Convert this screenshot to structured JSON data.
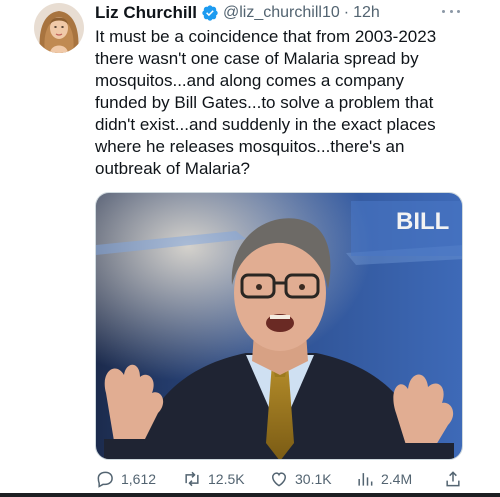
{
  "tweet": {
    "author_name": "Liz Churchill",
    "handle": "@liz_churchill10",
    "separator": "·",
    "time": "12h",
    "text_lines": [
      "It must be a coincidence that from 2003-2023",
      "there wasn't one case of Malaria spread by",
      "mosquitos...and along comes a company",
      "funded by Bill Gates...to solve a problem that",
      "didn't exist...and suddenly in the exact places",
      "where he releases mosquitos...there's an",
      "outbreak of Malaria?"
    ],
    "media": {
      "backdrop_text": "BILL"
    }
  },
  "actions": {
    "replies": "1,612",
    "reposts": "12.5K",
    "likes": "30.1K",
    "views": "2.4M"
  },
  "icons": [
    "verified-badge-icon",
    "more-icon",
    "reply-icon",
    "repost-icon",
    "like-icon",
    "views-icon",
    "share-icon"
  ],
  "colors": {
    "verified": "#1d9bf0",
    "text": "#0f1419",
    "secondary": "#536471"
  }
}
